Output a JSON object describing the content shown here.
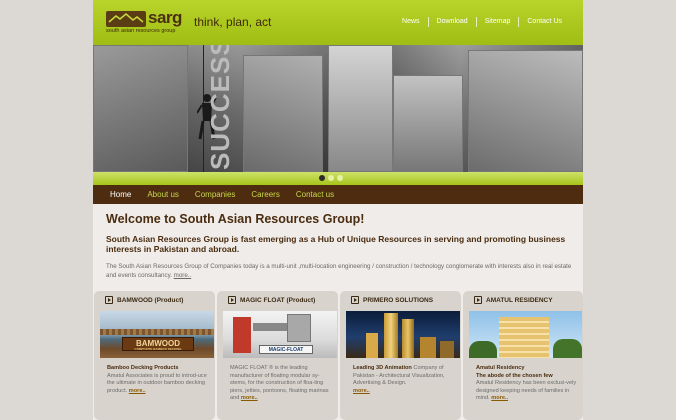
{
  "header": {
    "logo_word": "sarg",
    "logo_sub": "south asian resources group",
    "tagline": "think, plan, act",
    "nav": [
      "News",
      "Download",
      "Sitemap",
      "Contact Us"
    ]
  },
  "banner": {
    "text": "SUCCESS",
    "slides": 3,
    "active_slide": 1
  },
  "mainnav": {
    "items": [
      "Home",
      "About us",
      "Companies",
      "Careers",
      "Contact us"
    ],
    "current": "Home"
  },
  "content": {
    "welcome": "Welcome to South Asian Resources Group!",
    "intro": "South Asian Resources Group is fast emerging as a Hub of Unique Resources in serving and promoting business interests in Pakistan and abroad.",
    "body": "The South Asian Resources Group of Companies today is a multi-unit ,multi-location engineering / construction / technology conglomerate with interests also in real estate and events consultancy.",
    "body_more": "more.."
  },
  "cards": [
    {
      "title": "BAMWOOD (Product)",
      "img_label": "BAMWOOD",
      "img_sub": "COMPOSITE BAMBOO DECKING",
      "lead": "Bamboo Decking Products",
      "text": "Amatul Associates is proud to introd-uce the ultimate in outdoor bamboo decking product.",
      "more": "more.."
    },
    {
      "title": "MAGIC FLOAT (Product)",
      "img_label": "MAGIC-FLOAT",
      "lead": "",
      "text": "MAGIC FLOAT ® is the leading manufacturer of floating modular sy-stems, for the construction of floa-ting piers, jetties, pontoons, floating marinas and",
      "more": "more.."
    },
    {
      "title": "PRIMERO SOLUTIONS",
      "img_label": "",
      "lead": "Leading 3D Animation",
      "text": "Company of Pakistan - Architectural Visualization, Advertising & Design.",
      "more": "more.."
    },
    {
      "title": "AMATUL RESIDENCY",
      "img_label": "",
      "lead": "Amatul Residency",
      "lead2": "The abode of the chosen few",
      "text": "Amatul Residency has been exclusi-vely designed keeping needs of families in mind.",
      "more": "more.."
    }
  ]
}
